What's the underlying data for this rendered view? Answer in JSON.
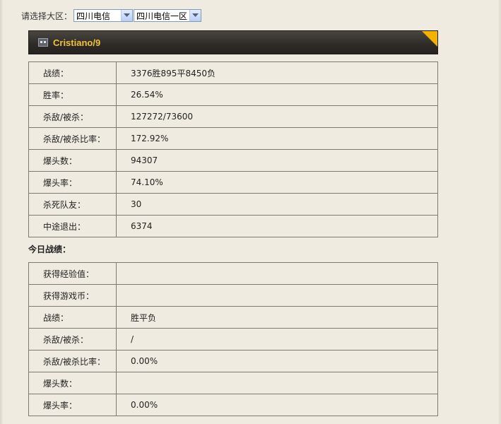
{
  "region": {
    "label": "请选择大区：",
    "zone_selected": "四川电信",
    "server_selected": "四川电信一区"
  },
  "player": {
    "name": "Cristiano/9",
    "accent_color": "#f2b200"
  },
  "overall": {
    "rows": [
      {
        "label": "战绩：",
        "value": "3376胜895平8450负"
      },
      {
        "label": "胜率：",
        "value": "26.54%"
      },
      {
        "label": "杀敌/被杀：",
        "value": "127272/73600"
      },
      {
        "label": "杀敌/被杀比率：",
        "value": "172.92%"
      },
      {
        "label": "爆头数：",
        "value": "94307"
      },
      {
        "label": "爆头率：",
        "value": "74.10%"
      },
      {
        "label": "杀死队友：",
        "value": "30"
      },
      {
        "label": "中途退出：",
        "value": "6374"
      }
    ]
  },
  "today": {
    "title": "今日战绩：",
    "rows": [
      {
        "label": "获得经验值：",
        "value": ""
      },
      {
        "label": "获得游戏币：",
        "value": ""
      },
      {
        "label": "战绩：",
        "value": "胜平负"
      },
      {
        "label": "杀敌/被杀：",
        "value": "/"
      },
      {
        "label": "杀敌/被杀比率：",
        "value": "0.00%"
      },
      {
        "label": "爆头数：",
        "value": ""
      },
      {
        "label": "爆头率：",
        "value": "0.00%"
      }
    ]
  }
}
